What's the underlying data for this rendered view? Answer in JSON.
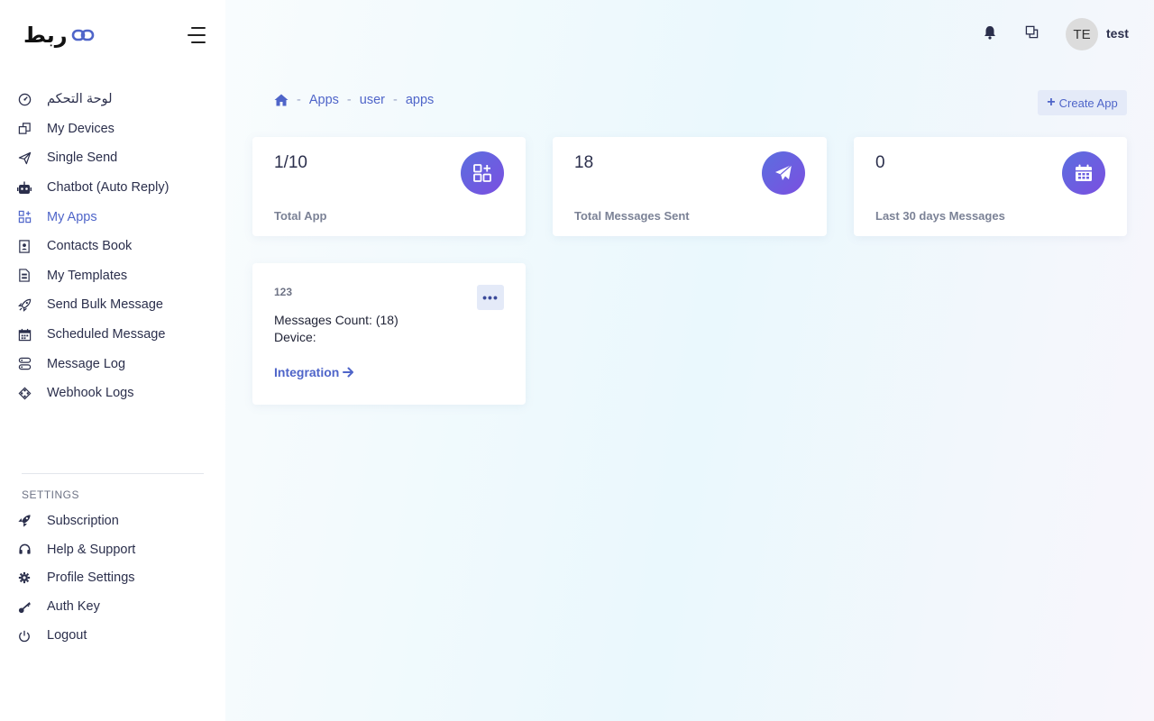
{
  "brand": {
    "logo_text": "ربط",
    "accent": "#4f65c9"
  },
  "sidebar": {
    "items": [
      {
        "label": "لوحة التحكم",
        "icon": "speedometer-icon"
      },
      {
        "label": "My Devices",
        "icon": "devices-icon"
      },
      {
        "label": "Single Send",
        "icon": "paper-plane-icon"
      },
      {
        "label": "Chatbot (Auto Reply)",
        "icon": "robot-icon"
      },
      {
        "label": "My Apps",
        "icon": "apps-grid-icon",
        "active": true
      },
      {
        "label": "Contacts Book",
        "icon": "contact-book-icon"
      },
      {
        "label": "My Templates",
        "icon": "template-icon"
      },
      {
        "label": "Send Bulk Message",
        "icon": "rocket-icon"
      },
      {
        "label": "Scheduled Message",
        "icon": "calendar-icon"
      },
      {
        "label": "Message Log",
        "icon": "log-icon"
      },
      {
        "label": "Webhook Logs",
        "icon": "webhook-icon"
      }
    ],
    "settings_title": "SETTINGS",
    "settings_items": [
      {
        "label": "Subscription",
        "icon": "rocket-icon"
      },
      {
        "label": "Help & Support",
        "icon": "headset-icon"
      },
      {
        "label": "Profile Settings",
        "icon": "gear-icon"
      },
      {
        "label": "Auth Key",
        "icon": "key-icon"
      },
      {
        "label": "Logout",
        "icon": "power-icon"
      }
    ]
  },
  "topbar": {
    "avatar_initials": "TE",
    "username": "test"
  },
  "breadcrumb": {
    "items": [
      "Apps",
      "user",
      "apps"
    ],
    "separator": "-"
  },
  "create_button": {
    "label": "Create App"
  },
  "stats": [
    {
      "value": "1/10",
      "label": "Total App",
      "icon": "apps-plus-icon"
    },
    {
      "value": "18",
      "label": "Total Messages Sent",
      "icon": "paper-plane-icon"
    },
    {
      "value": "0",
      "label": "Last 30 days Messages",
      "icon": "calendar-icon"
    }
  ],
  "app_card": {
    "name": "123",
    "more": "•••",
    "messages_count": "Messages Count: (18)",
    "device": "Device:",
    "integration_label": "Integration"
  }
}
